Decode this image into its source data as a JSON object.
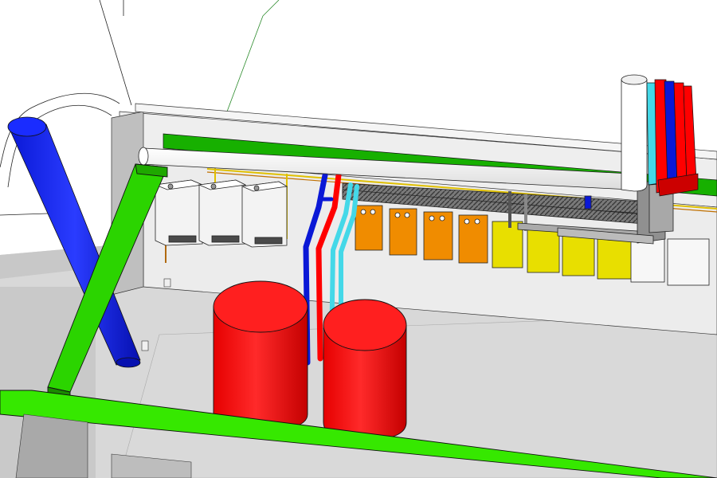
{
  "scene": {
    "title": "",
    "description_visible_text": []
  },
  "colors": {
    "background": "#ffffff",
    "floor": "#d9d9d9",
    "wall": "#e6e6e6",
    "wall_side": "#bdbdbd",
    "green_beam": "#2bd400",
    "green_beam_dark": "#1f9e00",
    "boiler_fill": "#f2f2f2",
    "tank_red": "#ff1a1a",
    "tank_red_dark": "#cc0000",
    "pipe_white": "#ffffff",
    "pipe_blue": "#0a1cff",
    "pipe_red": "#ff0000",
    "pipe_cyan": "#44d8e8",
    "orange_unit": "#f08c00",
    "yellow_unit": "#e8df00",
    "white_unit": "#f7f7f7",
    "insulation": "#606060",
    "outline": "#111111"
  },
  "components": {
    "boilers": [
      {
        "id": "boiler-1"
      },
      {
        "id": "boiler-2"
      },
      {
        "id": "boiler-3"
      }
    ],
    "tanks": [
      {
        "id": "tank-left",
        "color": "red"
      },
      {
        "id": "tank-right",
        "color": "red"
      }
    ],
    "manifold_units": [
      {
        "id": "unit-1",
        "color": "orange"
      },
      {
        "id": "unit-2",
        "color": "orange"
      },
      {
        "id": "unit-3",
        "color": "orange"
      },
      {
        "id": "unit-4",
        "color": "orange"
      },
      {
        "id": "unit-5",
        "color": "yellow"
      },
      {
        "id": "unit-6",
        "color": "yellow"
      },
      {
        "id": "unit-7",
        "color": "yellow"
      },
      {
        "id": "unit-8",
        "color": "yellow"
      },
      {
        "id": "unit-9",
        "color": "white"
      },
      {
        "id": "unit-10",
        "color": "white"
      }
    ],
    "pipes": [
      {
        "id": "flue-pipe-white",
        "color": "white"
      },
      {
        "id": "chimney-blue",
        "color": "blue"
      },
      {
        "id": "riser-blue",
        "color": "blue"
      },
      {
        "id": "riser-red",
        "color": "red"
      },
      {
        "id": "riser-cyan",
        "color": "cyan"
      }
    ]
  }
}
